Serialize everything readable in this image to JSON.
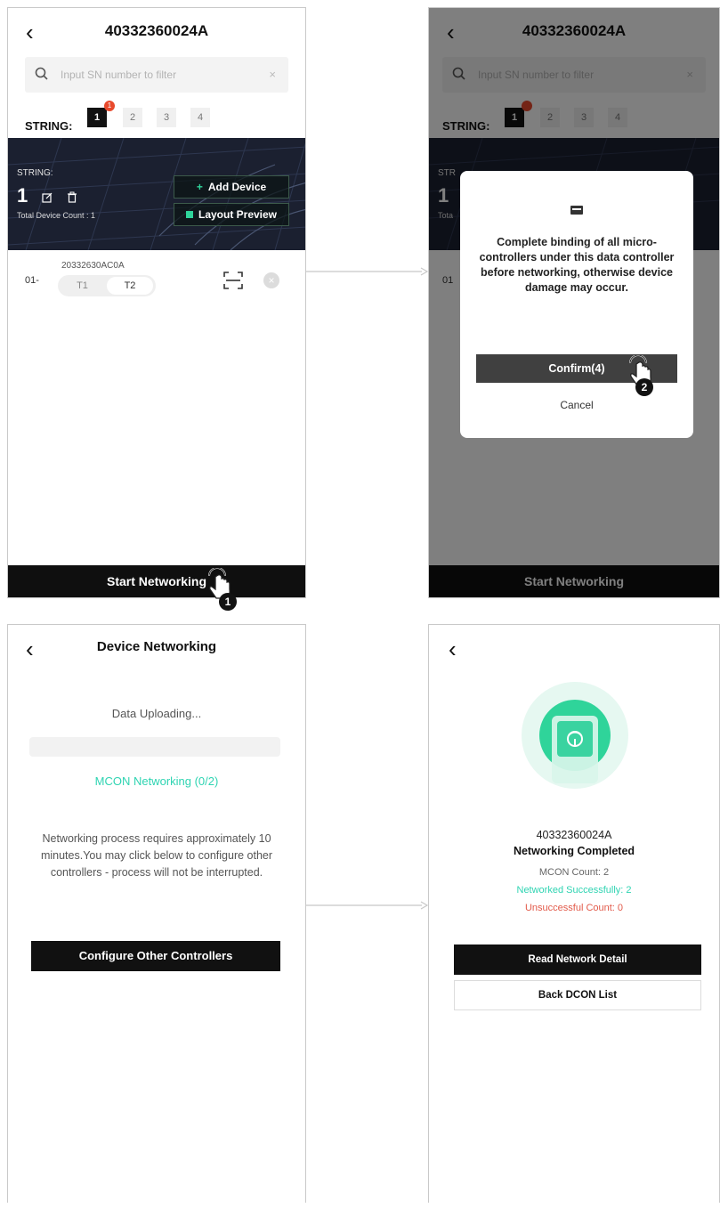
{
  "screen1": {
    "title": "40332360024A",
    "search_placeholder": "Input SN number to filter",
    "string_label": "STRING:",
    "tabs": [
      "1",
      "2",
      "3",
      "4"
    ],
    "badge": "1",
    "banner": {
      "string_label": "STRING:",
      "string_number": "1",
      "total_count": "Total Device Count : 1",
      "add_device": "Add Device",
      "layout_preview": "Layout Preview"
    },
    "device": {
      "index": "01-",
      "sn": "20332630AC0A",
      "t1": "T1",
      "t2": "T2"
    },
    "bottom_button": "Start Networking",
    "step": "1"
  },
  "screen2": {
    "title": "40332360024A",
    "search_placeholder": "Input SN number to filter",
    "string_label": "STRING:",
    "tabs": [
      "1",
      "2",
      "3",
      "4"
    ],
    "banner_string_label": "STR",
    "banner_number": "1",
    "banner_total": "Tota",
    "device_index": "01",
    "modal": {
      "message": "Complete binding of all micro-controllers under this data controller before networking, otherwise device damage may occur.",
      "confirm": "Confirm(4)",
      "cancel": "Cancel"
    },
    "bottom_button": "Start Networking",
    "step": "2"
  },
  "screen3": {
    "title": "Device Networking",
    "uploading": "Data Uploading...",
    "progress": 0,
    "status": "MCON Networking (0/2)",
    "note": "Networking process requires approximately 10 minutes.You may click below to configure other controllers - process will not be interrupted.",
    "button": "Configure Other Controllers"
  },
  "screen4": {
    "sn": "40332360024A",
    "title": "Networking Completed",
    "mcon_count": "MCON Count:  2",
    "success": "Networked Successfully:  2",
    "unsuccessful": "Unsuccessful Count:  0",
    "btn_detail": "Read Network Detail",
    "btn_back": "Back DCON List"
  },
  "colors": {
    "accent": "#2fd49a",
    "teal_text": "#2fd4b2",
    "error": "#e25a4a",
    "dark": "#111111",
    "badge": "#e8492c"
  }
}
